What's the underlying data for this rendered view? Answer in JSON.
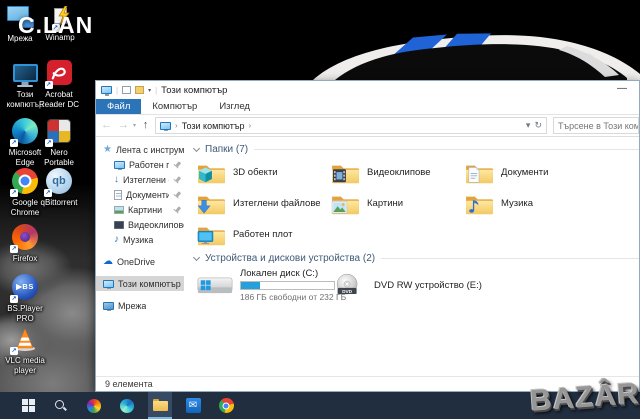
{
  "desktop": {
    "watermark_top_left": "C.LAN",
    "watermark_bottom_right": "BAZÂR",
    "top_icons": [
      {
        "label": "Мрежа",
        "icon": "network-computer-icon"
      },
      {
        "label": "Winamp",
        "icon": "winamp-lightning-icon"
      }
    ],
    "icons": [
      {
        "label": "Този компютър",
        "icon": "this-pc-icon"
      },
      {
        "label": "Acrobat Reader DC",
        "icon": "acrobat-reader-icon"
      },
      {
        "label": "Microsoft Edge",
        "icon": "edge-icon"
      },
      {
        "label": "Nero Portable",
        "icon": "nero-icon"
      },
      {
        "label": "Google Chrome",
        "icon": "chrome-icon"
      },
      {
        "label": "qBittorrent",
        "icon": "qbittorrent-icon",
        "icon_text": "qb"
      },
      {
        "label": "Firefox",
        "icon": "firefox-icon"
      },
      {
        "label": "BS.Player PRO",
        "icon": "bsplayer-icon",
        "icon_text": "▶BS"
      },
      {
        "label": "VLC media player",
        "icon": "vlc-cone-icon"
      }
    ]
  },
  "explorer": {
    "title_bar": {
      "title": "Този компютър",
      "minimize": "—"
    },
    "ribbon_tabs": [
      {
        "label": "Файл",
        "active": true
      },
      {
        "label": "Компютър",
        "active": false
      },
      {
        "label": "Изглед",
        "active": false
      }
    ],
    "address_bar": {
      "breadcrumb": "Този компютър",
      "search_placeholder": "Търсене в Този компютър"
    },
    "nav": {
      "items": [
        {
          "label": "Лента с инструменти",
          "icon": "quick-access-star-icon",
          "pinned": false
        },
        {
          "label": "Работен плот",
          "icon": "desktop-icon",
          "pinned": true
        },
        {
          "label": "Изтеглени файлове",
          "icon": "downloads-arrow-icon",
          "pinned": true
        },
        {
          "label": "Документи",
          "icon": "documents-page-icon",
          "pinned": true
        },
        {
          "label": "Картини",
          "icon": "pictures-icon",
          "pinned": true
        },
        {
          "label": "Видеоклипове",
          "icon": "videos-icon",
          "pinned": false
        },
        {
          "label": "Музика",
          "icon": "music-note-icon",
          "pinned": false
        },
        {
          "label": "OneDrive",
          "icon": "onedrive-cloud-icon",
          "pinned": false
        },
        {
          "label": "Този компютър",
          "icon": "this-pc-icon",
          "selected": true
        },
        {
          "label": "Мрежа",
          "icon": "network-icon",
          "pinned": false
        }
      ]
    },
    "groups": {
      "folders": {
        "header": "Папки (7)",
        "items": [
          {
            "label": "3D обекти",
            "icon": "folder-3d-objects-icon"
          },
          {
            "label": "Видеоклипове",
            "icon": "folder-videos-icon"
          },
          {
            "label": "Документи",
            "icon": "folder-documents-icon"
          },
          {
            "label": "Изтеглени файлове",
            "icon": "folder-downloads-icon"
          },
          {
            "label": "Картини",
            "icon": "folder-pictures-icon"
          },
          {
            "label": "Музика",
            "icon": "folder-music-icon"
          },
          {
            "label": "Работен плот",
            "icon": "folder-desktop-icon"
          }
        ]
      },
      "devices": {
        "header": "Устройства и дискови устройства (2)",
        "drives": [
          {
            "label": "Локален диск (C:)",
            "free_text": "186 ГБ свободни от 232 ГБ",
            "used_percent": 20,
            "icon": "local-disk-icon"
          },
          {
            "label": "DVD RW устройство (E:)",
            "icon_text": "DVD",
            "icon": "dvd-drive-icon"
          }
        ]
      }
    },
    "status_bar": {
      "items_count": "9 елемента"
    }
  },
  "taskbar": {
    "items": [
      "start",
      "search",
      "color-wheel-app",
      "edge",
      "file-explorer",
      "mail",
      "chrome"
    ],
    "active_app": "file-explorer"
  },
  "glyphs": {
    "minimize": "—",
    "back": "←",
    "forward": "→",
    "up": "↑",
    "dropdown": "▾",
    "refresh": "↻",
    "crumb_sep": "›",
    "star": "★",
    "music_note": "♪",
    "cloud": "☁",
    "down_arrow": "↓",
    "shortcut_arrow": "↗",
    "mail": "✉"
  },
  "colors": {
    "accent_blue": "#2b74b8",
    "selection_gray": "#d5d5d5",
    "drive_bar_fill": "#26a0da",
    "taskbar_bg": "#212e40"
  }
}
